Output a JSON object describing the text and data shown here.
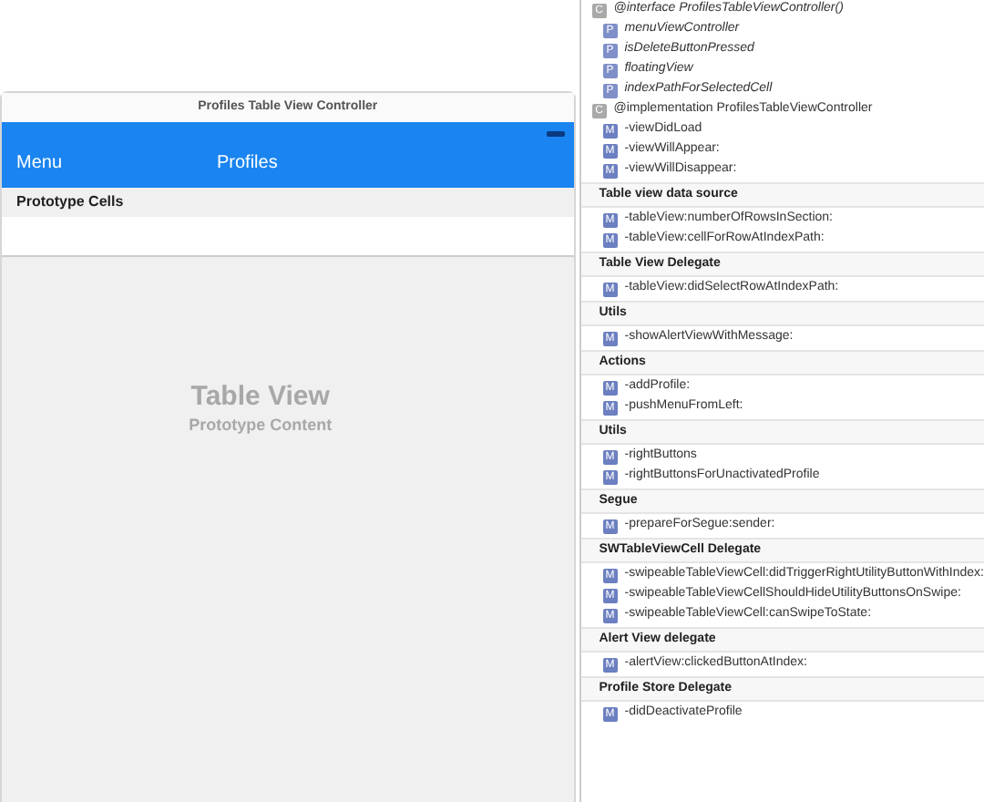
{
  "scene": {
    "title": "Profiles Table View Controller",
    "nav_left": "Menu",
    "nav_title": "Profiles",
    "section_header": "Prototype Cells",
    "placeholder_title": "Table View",
    "placeholder_subtitle": "Prototype Content"
  },
  "outline": [
    {
      "kind": "class",
      "icon": "C",
      "text": "@interface ProfilesTableViewController()",
      "italic": true
    },
    {
      "kind": "property",
      "icon": "P",
      "text": "menuViewController"
    },
    {
      "kind": "property",
      "icon": "P",
      "text": "isDeleteButtonPressed"
    },
    {
      "kind": "property",
      "icon": "P",
      "text": "floatingView"
    },
    {
      "kind": "property",
      "icon": "P",
      "text": "indexPathForSelectedCell"
    },
    {
      "kind": "class",
      "icon": "C",
      "text": "@implementation ProfilesTableViewController",
      "italic": false
    },
    {
      "kind": "method",
      "icon": "M",
      "text": "-viewDidLoad"
    },
    {
      "kind": "method",
      "icon": "M",
      "text": "-viewWillAppear:"
    },
    {
      "kind": "method",
      "icon": "M",
      "text": "-viewWillDisappear:"
    },
    {
      "kind": "section",
      "text": "Table view data source"
    },
    {
      "kind": "method",
      "icon": "M",
      "text": "-tableView:numberOfRowsInSection:"
    },
    {
      "kind": "method",
      "icon": "M",
      "text": "-tableView:cellForRowAtIndexPath:"
    },
    {
      "kind": "section",
      "text": "Table View Delegate"
    },
    {
      "kind": "method",
      "icon": "M",
      "text": "-tableView:didSelectRowAtIndexPath:"
    },
    {
      "kind": "section",
      "text": "Utils"
    },
    {
      "kind": "method",
      "icon": "M",
      "text": "-showAlertViewWithMessage:"
    },
    {
      "kind": "section",
      "text": "Actions"
    },
    {
      "kind": "method",
      "icon": "M",
      "text": "-addProfile:"
    },
    {
      "kind": "method",
      "icon": "M",
      "text": "-pushMenuFromLeft:"
    },
    {
      "kind": "section",
      "text": "Utils"
    },
    {
      "kind": "method",
      "icon": "M",
      "text": "-rightButtons"
    },
    {
      "kind": "method",
      "icon": "M",
      "text": "-rightButtonsForUnactivatedProfile"
    },
    {
      "kind": "section",
      "text": "Segue"
    },
    {
      "kind": "method",
      "icon": "M",
      "text": "-prepareForSegue:sender:"
    },
    {
      "kind": "section",
      "text": "SWTableViewCell Delegate"
    },
    {
      "kind": "method",
      "icon": "M",
      "text": "-swipeableTableViewCell:didTriggerRightUtilityButtonWithIndex:"
    },
    {
      "kind": "method",
      "icon": "M",
      "text": "-swipeableTableViewCellShouldHideUtilityButtonsOnSwipe:"
    },
    {
      "kind": "method",
      "icon": "M",
      "text": "-swipeableTableViewCell:canSwipeToState:"
    },
    {
      "kind": "section",
      "text": "Alert View delegate"
    },
    {
      "kind": "method",
      "icon": "M",
      "text": "-alertView:clickedButtonAtIndex:"
    },
    {
      "kind": "section",
      "text": "Profile Store Delegate"
    },
    {
      "kind": "method",
      "icon": "M",
      "text": "-didDeactivateProfile"
    }
  ]
}
